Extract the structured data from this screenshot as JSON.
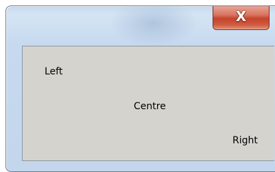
{
  "window": {
    "close_glyph": "X"
  },
  "client": {
    "labels": {
      "left": "Left",
      "centre": "Centre",
      "right": "Right"
    }
  },
  "colors": {
    "client_background": "#d4d3ce",
    "close_button_red": "#c4442d",
    "frame_blue": "#c6d9ee"
  }
}
